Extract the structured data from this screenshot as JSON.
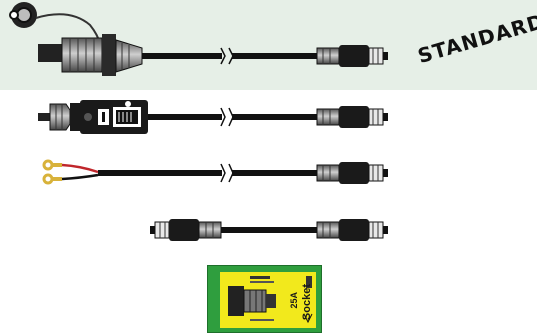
{
  "banner": {
    "label": "STANDARD",
    "background": "#e6efe7"
  },
  "products": [
    {
      "name": "standard-plug-cable",
      "icon": "standard-socket-plug-icon"
    },
    {
      "name": "din-plug-cable",
      "icon": "din-plug-icon"
    },
    {
      "name": "ring-terminal-cable",
      "icon": "ring-terminal-icon"
    },
    {
      "name": "double-ended-cable",
      "icon": "double-connector-icon"
    }
  ],
  "package": {
    "title": "Socket",
    "rating": "25A",
    "colors": {
      "outer": "#2f9e3e",
      "inner": "#f2e91c"
    }
  },
  "colors": {
    "cable": "#111111",
    "wire_red": "#c0262b",
    "terminal_gold": "#d8b23a"
  }
}
